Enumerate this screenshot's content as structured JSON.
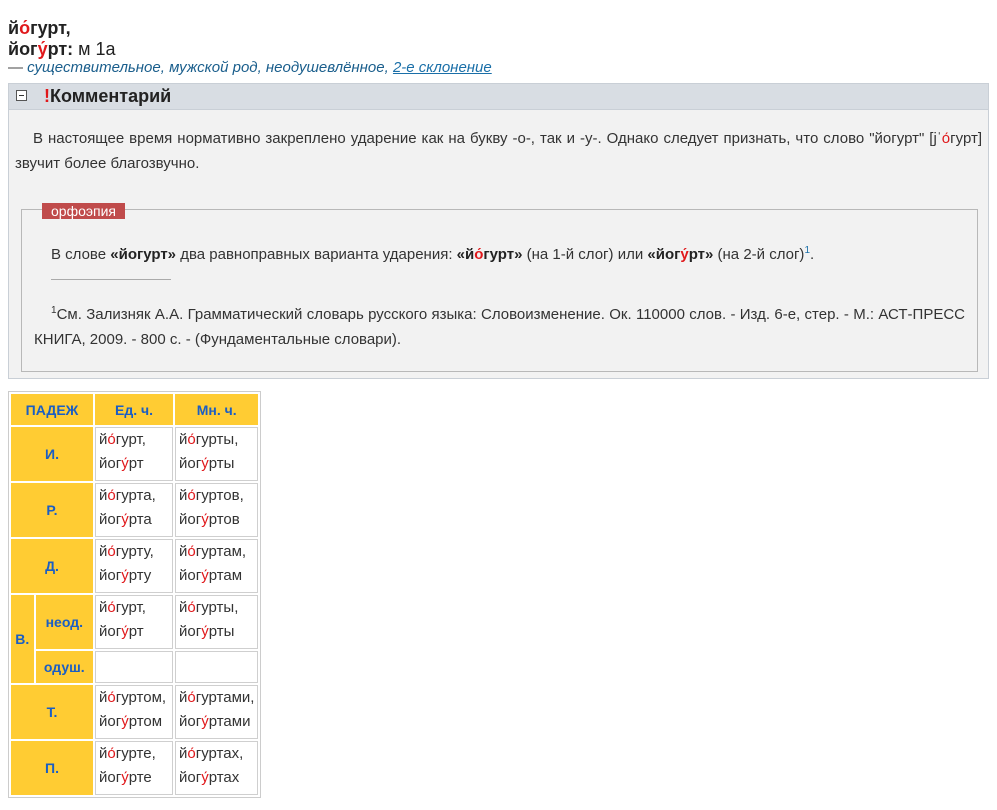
{
  "headword": {
    "line1": {
      "pre": "й",
      "accent": "о́",
      "post": "гурт,"
    },
    "line2": {
      "pre": "йог",
      "accent": "у́",
      "post": "рт:",
      "gram": " м 1а"
    },
    "desc_dash": "— ",
    "desc_italic": "существительное, мужской род, неодушевлённое,",
    "desc_link": "2-е склонение"
  },
  "comment": {
    "toggle": "−",
    "excl": "!",
    "title": "Комментарий",
    "text_a": "В настоящее время нормативно закреплено ударение как на букву -о-, так и -у-. Однако следует признать, что слово \"йогурт\" [jˈ",
    "text_acc": "о́",
    "text_b": "гурт] звучит более благозвучно."
  },
  "ortho": {
    "tag": "орфоэпия",
    "p1_pre": "В слове ",
    "w_plain": "«йогурт»",
    "p1_mid": " два равноправных варианта ударения: ",
    "v1_pre": "«й",
    "v1_acc": "о́",
    "v1_post": "гурт»",
    "p1_mid2": " (на 1-й слог) или ",
    "v2_pre": "«йог",
    "v2_acc": "у́",
    "v2_post": "рт»",
    "p1_end": " (на 2-й слог)",
    "p1_sup": "1",
    "p1_dot": ".",
    "note_sup": "1",
    "note": "См. Зализняк А.А. Грамматический словарь русского языка: Словоизменение. Ок. 110000 слов. - Изд. 6-е, стер. - М.: АСТ-ПРЕСС КНИГА, 2009. - 800 с. - (Фундаментальные словари)."
  },
  "table": {
    "headers": {
      "case": "ПАДЕЖ",
      "sg": "Ед. ч.",
      "pl": "Мн. ч."
    },
    "cases": {
      "nom": "И.",
      "gen": "Р.",
      "dat": "Д.",
      "acc": "В.",
      "acc_inan": "неод.",
      "acc_anim": "одуш.",
      "ins": "Т.",
      "prep": "П."
    },
    "forms": {
      "nom_sg": {
        "a_pre": "й",
        "a_acc": "о́",
        "a_post": "гурт,",
        "b_pre": "йог",
        "b_acc": "у́",
        "b_post": "рт"
      },
      "nom_pl": {
        "a_pre": "й",
        "a_acc": "о́",
        "a_post": "гурты,",
        "b_pre": "йог",
        "b_acc": "у́",
        "b_post": "рты"
      },
      "gen_sg": {
        "a_pre": "й",
        "a_acc": "о́",
        "a_post": "гурта,",
        "b_pre": "йог",
        "b_acc": "у́",
        "b_post": "рта"
      },
      "gen_pl": {
        "a_pre": "й",
        "a_acc": "о́",
        "a_post": "гуртов,",
        "b_pre": "йог",
        "b_acc": "у́",
        "b_post": "ртов"
      },
      "dat_sg": {
        "a_pre": "й",
        "a_acc": "о́",
        "a_post": "гурту,",
        "b_pre": "йог",
        "b_acc": "у́",
        "b_post": "рту"
      },
      "dat_pl": {
        "a_pre": "й",
        "a_acc": "о́",
        "a_post": "гуртам,",
        "b_pre": "йог",
        "b_acc": "у́",
        "b_post": "ртам"
      },
      "acc_sg": {
        "a_pre": "й",
        "a_acc": "о́",
        "a_post": "гурт,",
        "b_pre": "йог",
        "b_acc": "у́",
        "b_post": "рт"
      },
      "acc_pl": {
        "a_pre": "й",
        "a_acc": "о́",
        "a_post": "гурты,",
        "b_pre": "йог",
        "b_acc": "у́",
        "b_post": "рты"
      },
      "ins_sg": {
        "a_pre": "й",
        "a_acc": "о́",
        "a_post": "гуртом,",
        "b_pre": "йог",
        "b_acc": "у́",
        "b_post": "ртом"
      },
      "ins_pl": {
        "a_pre": "й",
        "a_acc": "о́",
        "a_post": "гуртами,",
        "b_pre": "йог",
        "b_acc": "у́",
        "b_post": "ртами"
      },
      "prep_sg": {
        "a_pre": "й",
        "a_acc": "о́",
        "a_post": "гурте,",
        "b_pre": "йог",
        "b_acc": "у́",
        "b_post": "рте"
      },
      "prep_pl": {
        "a_pre": "й",
        "a_acc": "о́",
        "a_post": "гуртах,",
        "b_pre": "йог",
        "b_acc": "у́",
        "b_post": "ртах"
      }
    }
  },
  "colors": {
    "accent": "#e0181b",
    "header_bg": "#ffcc33",
    "header_text": "#1a5ec4",
    "link": "#1a6fa8",
    "ortho_tag": "#c04b4b"
  }
}
